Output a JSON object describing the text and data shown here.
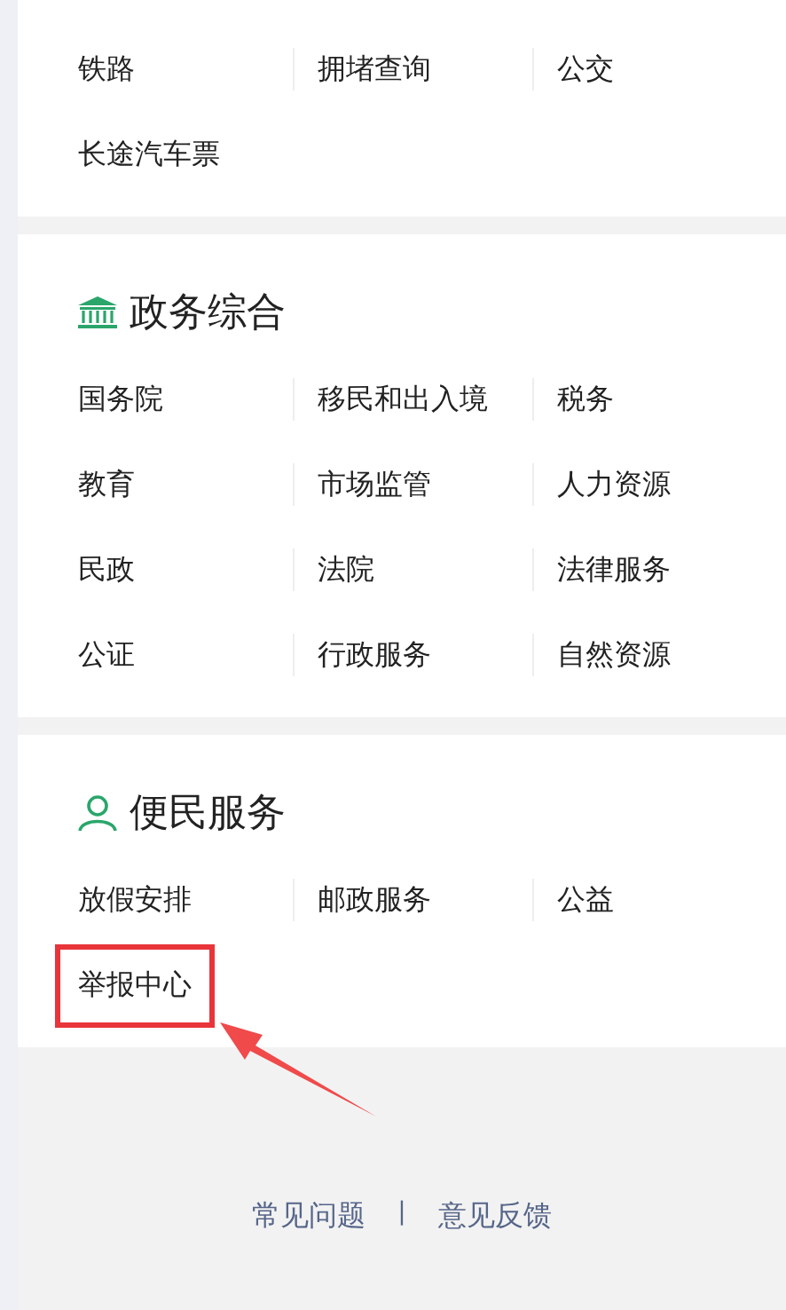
{
  "sections": [
    {
      "rows": [
        [
          {
            "label": "铁路",
            "highlighted": false
          },
          {
            "label": "拥堵查询",
            "highlighted": false
          },
          {
            "label": "公交",
            "highlighted": false
          }
        ],
        [
          {
            "label": "长途汽车票",
            "highlighted": false
          }
        ]
      ]
    },
    {
      "title": "政务综合",
      "kind": "government",
      "rows": [
        [
          {
            "label": "国务院",
            "highlighted": false
          },
          {
            "label": "移民和出入境",
            "highlighted": false
          },
          {
            "label": "税务",
            "highlighted": false
          }
        ],
        [
          {
            "label": "教育",
            "highlighted": false
          },
          {
            "label": "市场监管",
            "highlighted": false
          },
          {
            "label": "人力资源",
            "highlighted": false
          }
        ],
        [
          {
            "label": "民政",
            "highlighted": false
          },
          {
            "label": "法院",
            "highlighted": false
          },
          {
            "label": "法律服务",
            "highlighted": false
          }
        ],
        [
          {
            "label": "公证",
            "highlighted": false
          },
          {
            "label": "行政服务",
            "highlighted": false
          },
          {
            "label": "自然资源",
            "highlighted": false
          }
        ]
      ]
    },
    {
      "title": "便民服务",
      "kind": "services",
      "rows": [
        [
          {
            "label": "放假安排",
            "highlighted": false
          },
          {
            "label": "邮政服务",
            "highlighted": false
          },
          {
            "label": "公益",
            "highlighted": false
          }
        ],
        [
          {
            "label": "举报中心",
            "highlighted": true
          }
        ]
      ]
    }
  ],
  "footer": {
    "links": [
      "常见问题",
      "意见反馈"
    ],
    "separator": "|"
  }
}
